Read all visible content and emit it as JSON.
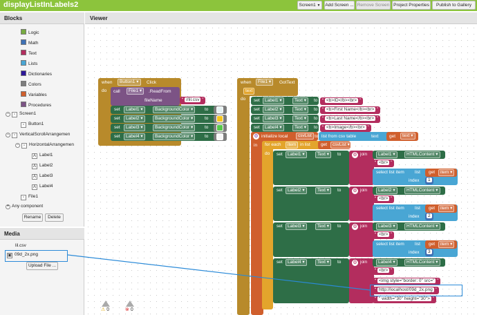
{
  "app": {
    "project_title": "displayListInLabels2",
    "screen_select": "Screen1",
    "add_screen": "Add Screen ...",
    "remove_screen": "Remove Screen",
    "project_properties": "Project Properties",
    "publish": "Publish to Gallery"
  },
  "blocks_panel": {
    "title": "Blocks",
    "builtin": [
      {
        "label": "Logic",
        "color": "#77ab41"
      },
      {
        "label": "Math",
        "color": "#3f71b5"
      },
      {
        "label": "Text",
        "color": "#b32d5e"
      },
      {
        "label": "Lists",
        "color": "#49a6d4"
      },
      {
        "label": "Dictionaries",
        "color": "#2d1799"
      },
      {
        "label": "Colors",
        "color": "#7d7d7d"
      },
      {
        "label": "Variables",
        "color": "#d05f2d"
      },
      {
        "label": "Procedures",
        "color": "#7c5385"
      }
    ],
    "components": [
      {
        "label": "Screen1",
        "toggle": "−"
      },
      {
        "label": "Button1"
      },
      {
        "label": "VerticalScrollArrangemen",
        "toggle": "−"
      },
      {
        "label": "HorizontalArrangemen",
        "toggle": "−"
      },
      {
        "label": "Label1"
      },
      {
        "label": "Label2"
      },
      {
        "label": "Label3"
      },
      {
        "label": "Label4"
      },
      {
        "label": "File1"
      }
    ],
    "any_component": "Any component",
    "rename": "Rename",
    "delete": "Delete"
  },
  "media_panel": {
    "title": "Media",
    "files": [
      "lil.csv",
      "09d_2x.png"
    ],
    "upload": "Upload File ..."
  },
  "viewer": {
    "title": "Viewer",
    "warnings": "0",
    "errors": "0"
  },
  "button_block": {
    "when": "when",
    "component": "Button1",
    "event": "Click",
    "do": "do",
    "call": "call",
    "file": "File1",
    "method": ".ReadFrom",
    "filename_label": "fileName",
    "filename_value": "//lil.csv",
    "set": "set",
    "to": "to",
    "property": "BackgroundColor",
    "labels": [
      "Label1",
      "Label2",
      "Label3",
      "Label4"
    ],
    "colors": [
      "#e6f2f2",
      "#f5c51c",
      "#57c84a",
      "#f7f7f7"
    ]
  },
  "file_block": {
    "when": "when",
    "component": "File1",
    "event": "GotText",
    "param": "text",
    "do": "do",
    "set": "set",
    "to": "to",
    "property": "Text",
    "header_sets": [
      {
        "label": "Label1",
        "value": "<b>ID</b><br>"
      },
      {
        "label": "Label2",
        "value": "<b>First Name</b><br>"
      },
      {
        "label": "Label3",
        "value": "<b>Last Name</b><br>"
      },
      {
        "label": "Label4",
        "value": "<b>Image</b><br>"
      }
    ],
    "init_local": "initialize local",
    "local_var": "csvList",
    "to_word": "to",
    "list_from_csv": "list from csv table",
    "text_kw": "text",
    "get": "get",
    "text_var": "text",
    "in": "in",
    "for_each": "for each",
    "item": "item",
    "in_list": "in list",
    "list_var": "csvList",
    "do_kw": "do",
    "join": "join",
    "html_content": "HTMLContent",
    "br": "<br>",
    "select_list_item": "select list item",
    "list_kw": "list",
    "index_kw": "index",
    "item_var": "item",
    "rows": [
      {
        "label": "Label1",
        "index": "1"
      },
      {
        "label": "Label2",
        "index": "2"
      },
      {
        "label": "Label3",
        "index": "3"
      },
      {
        "label": "Label4"
      }
    ],
    "img_open": "<img style=\"border: 0\" src=\"",
    "img_url": "http://localhost/09d_2x.png",
    "img_close": "\" width=\"30\" height=\"30\">"
  }
}
